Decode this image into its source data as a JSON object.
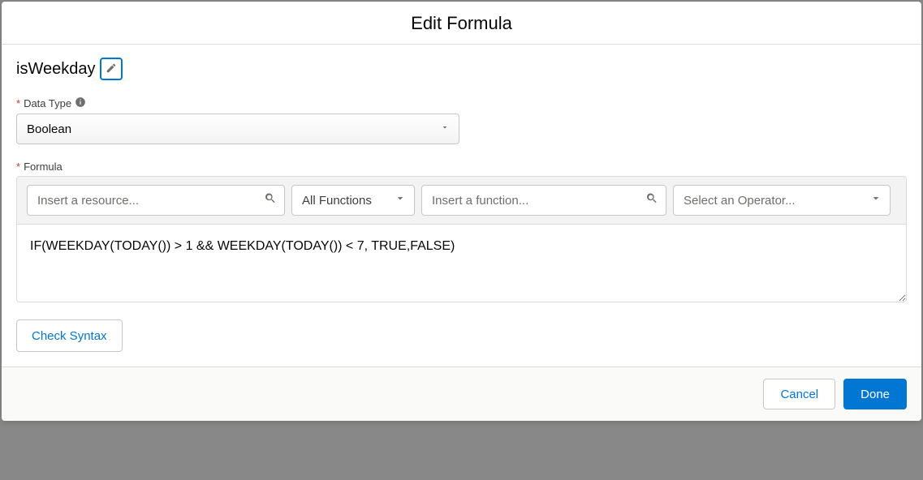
{
  "header": {
    "title": "Edit Formula"
  },
  "name": {
    "value": "isWeekday"
  },
  "dataType": {
    "label": "Data Type",
    "value": "Boolean"
  },
  "formula": {
    "label": "Formula",
    "resourcePlaceholder": "Insert a resource...",
    "functionCategory": "All Functions",
    "functionPlaceholder": "Insert a function...",
    "operatorPlaceholder": "Select an Operator...",
    "body": "IF(WEEKDAY(TODAY()) > 1 && WEEKDAY(TODAY()) < 7, TRUE,FALSE)"
  },
  "buttons": {
    "checkSyntax": "Check Syntax",
    "cancel": "Cancel",
    "done": "Done"
  }
}
